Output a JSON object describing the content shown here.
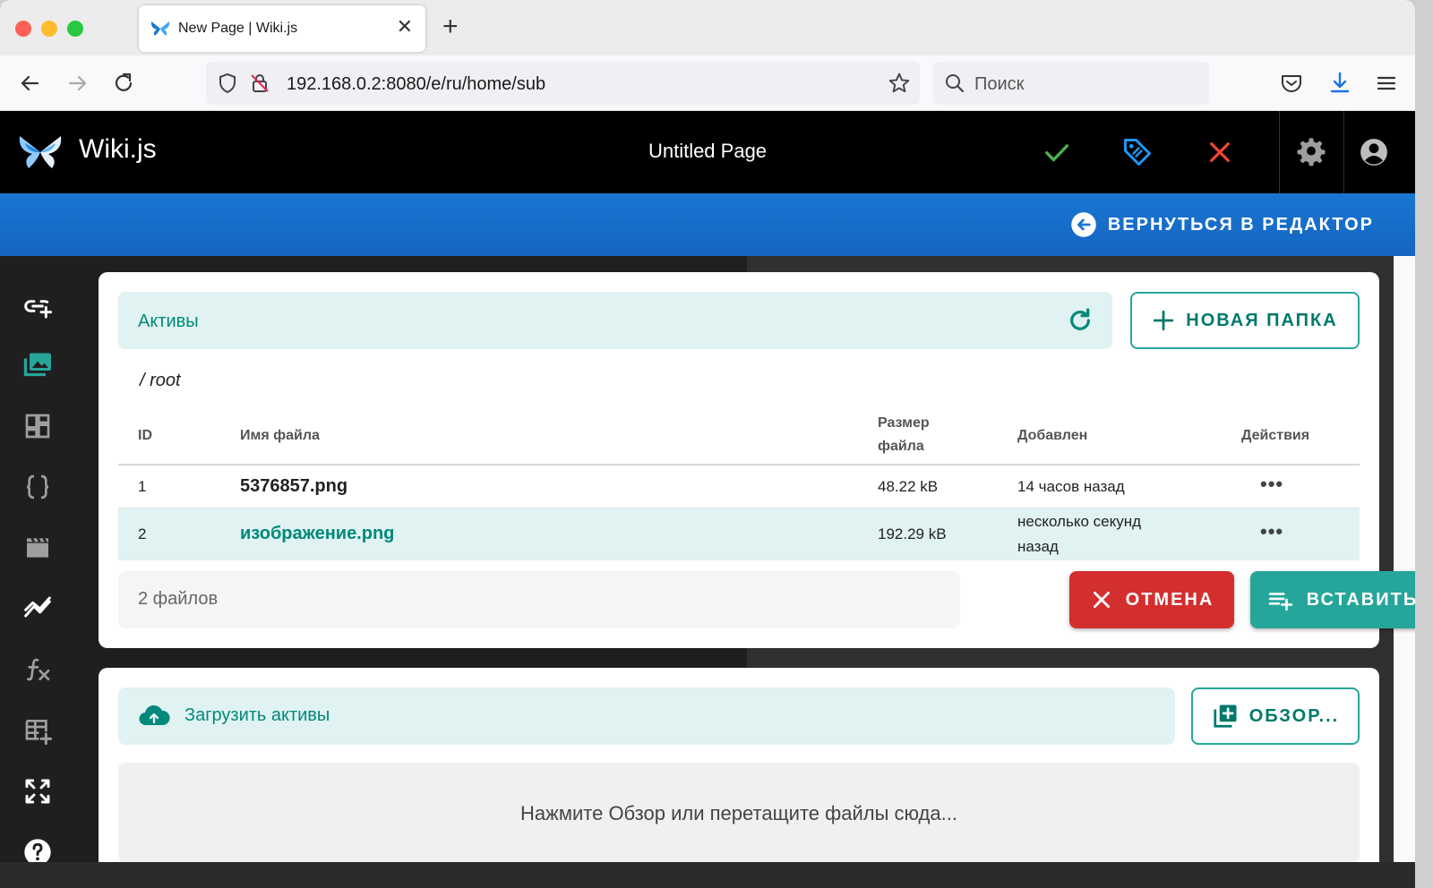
{
  "browser": {
    "tab_title": "New Page | Wiki.js",
    "url": "192.168.0.2:8080/e/ru/home/sub",
    "search_placeholder": "Поиск"
  },
  "header": {
    "brand": "Wiki.js",
    "page_title": "Untitled Page"
  },
  "bar": {
    "back_label": "ВЕРНУТЬСЯ В РЕДАКТОР"
  },
  "assets": {
    "title": "Активы",
    "new_folder_label": "НОВАЯ ПАПКА",
    "path": "/ root",
    "columns": [
      "ID",
      "Имя файла",
      "Размер файла",
      "Добавлен",
      "Действия"
    ],
    "rows": [
      {
        "id": "1",
        "name": "5376857.png",
        "size": "48.22 kB",
        "added": "14 часов назад",
        "selected": false
      },
      {
        "id": "2",
        "name": "изображение.png",
        "size": "192.29 kB",
        "added": "несколько секунд назад",
        "selected": true
      }
    ],
    "count": "2 файлов",
    "cancel_label": "ОТМЕНА",
    "insert_label": "ВСТАВИТЬ"
  },
  "upload": {
    "title": "Загрузить активы",
    "browse_label": "ОБЗОР...",
    "drop_text": "Нажмите Обзор или перетащите файлы сюда..."
  },
  "colors": {
    "accent": "#26a69a",
    "primary_blue": "#1976d2",
    "danger": "#d32f2f"
  }
}
